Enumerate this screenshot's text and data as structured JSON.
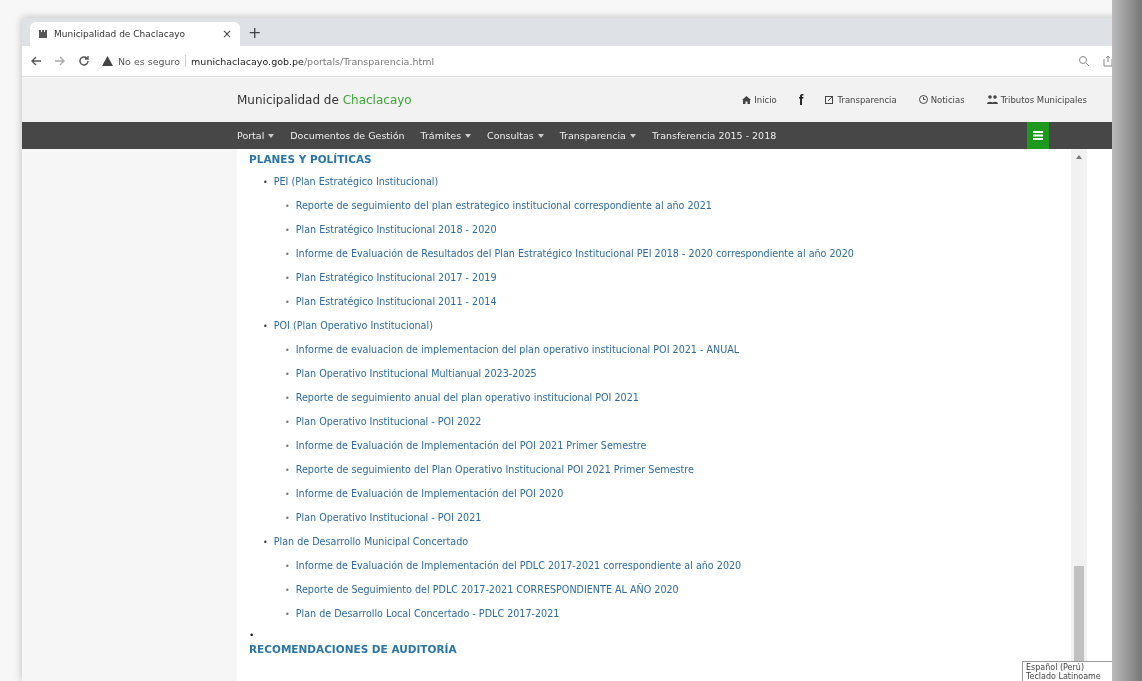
{
  "browser": {
    "tab": {
      "title": "Municipalidad de Chaclacayo",
      "close": "×"
    },
    "new_tab": "+",
    "security": "No es seguro",
    "url_host": "munichaclacayo.gob.pe",
    "url_path": "/portals/Transparencia.html"
  },
  "site": {
    "brand": "Municipalidad de ",
    "brand_accent": "Chaclacayo",
    "top_links": [
      {
        "label": "Inicio",
        "kind": "home"
      },
      {
        "label": "f",
        "kind": "facebook"
      },
      {
        "label": "Transparencia",
        "kind": "edit"
      },
      {
        "label": "Noticias",
        "kind": "clock"
      },
      {
        "label": "Tributos Municipales",
        "kind": "people"
      }
    ],
    "nav": [
      {
        "label": "Portal",
        "dropdown": true
      },
      {
        "label": "Documentos de Gestión",
        "dropdown": false
      },
      {
        "label": "Trámites",
        "dropdown": true
      },
      {
        "label": "Consultas",
        "dropdown": true
      },
      {
        "label": "Transparencia",
        "dropdown": true
      },
      {
        "label": "Transferencia 2015 - 2018",
        "dropdown": false
      }
    ]
  },
  "content": {
    "heading": "PLANES Y POLÍTICAS",
    "groups": [
      {
        "bullet": "•",
        "title": "PEI (Plan Estratégico Institucional)",
        "children": [
          {
            "bullet": "•",
            "title": "Reporte de seguimiento del plan estrategico institucional correspondiente al año 2021"
          },
          {
            "bullet": "•",
            "title": "Plan Estratégico Institucional 2018 - 2020"
          },
          {
            "bullet": "•",
            "title": "Informe de Evaluación de Resultados del Plan Estratégico Institucional PEI 2018 - 2020 correspondiente al año 2020"
          },
          {
            "bullet": "•",
            "title": "Plan Estratégico Institucional 2017 - 2019"
          },
          {
            "bullet": "•",
            "title": "Plan Estratégico Institucional 2011 - 2014"
          }
        ]
      },
      {
        "bullet": "•",
        "title": "POI (Plan Operativo Institucional)",
        "children": [
          {
            "bullet": "•",
            "title": "Informe de evaluacion de implementacion del plan operativo institucional POI 2021 - ANUAL"
          },
          {
            "bullet": "•",
            "title": "Plan Operativo Institucional Multianual 2023-2025"
          },
          {
            "bullet": "•",
            "title": "Reporte de seguimiento anual del plan operativo institucional POI 2021"
          },
          {
            "bullet": "•",
            "title": "Plan Operativo Institucional - POI 2022"
          },
          {
            "bullet": "•",
            "title": "Informe de Evaluación de Implementación del POI 2021 Primer Semestre"
          },
          {
            "bullet": "•",
            "title": "Reporte de seguimiento del Plan Operativo Institucional POI 2021 Primer Semestre"
          },
          {
            "bullet": "•",
            "title": "Informe de Evaluación de Implementación del POI 2020"
          },
          {
            "bullet": "•",
            "title": "Plan Operativo Institucional - POI 2021"
          }
        ]
      },
      {
        "bullet": "•",
        "title": "Plan de Desarrollo Municipal Concertado",
        "children": [
          {
            "bullet": "•",
            "title": "Informe de Evaluación de Implementación del PDLC 2017-2021 correspondiente al año 2020"
          },
          {
            "bullet": "•",
            "title": "Reporte de Seguimiento del PDLC 2017-2021 CORRESPONDIENTE AL AÑO 2020"
          },
          {
            "bullet": "•",
            "title": "Plan de Desarrollo Local Concertado - PDLC 2017-2021"
          }
        ]
      }
    ],
    "next_bullet": "•",
    "next_heading": "RECOMENDACIONES DE AUDITORÍA"
  },
  "tooltip": [
    "Español (Perú)",
    "Teclado Latinoame"
  ]
}
